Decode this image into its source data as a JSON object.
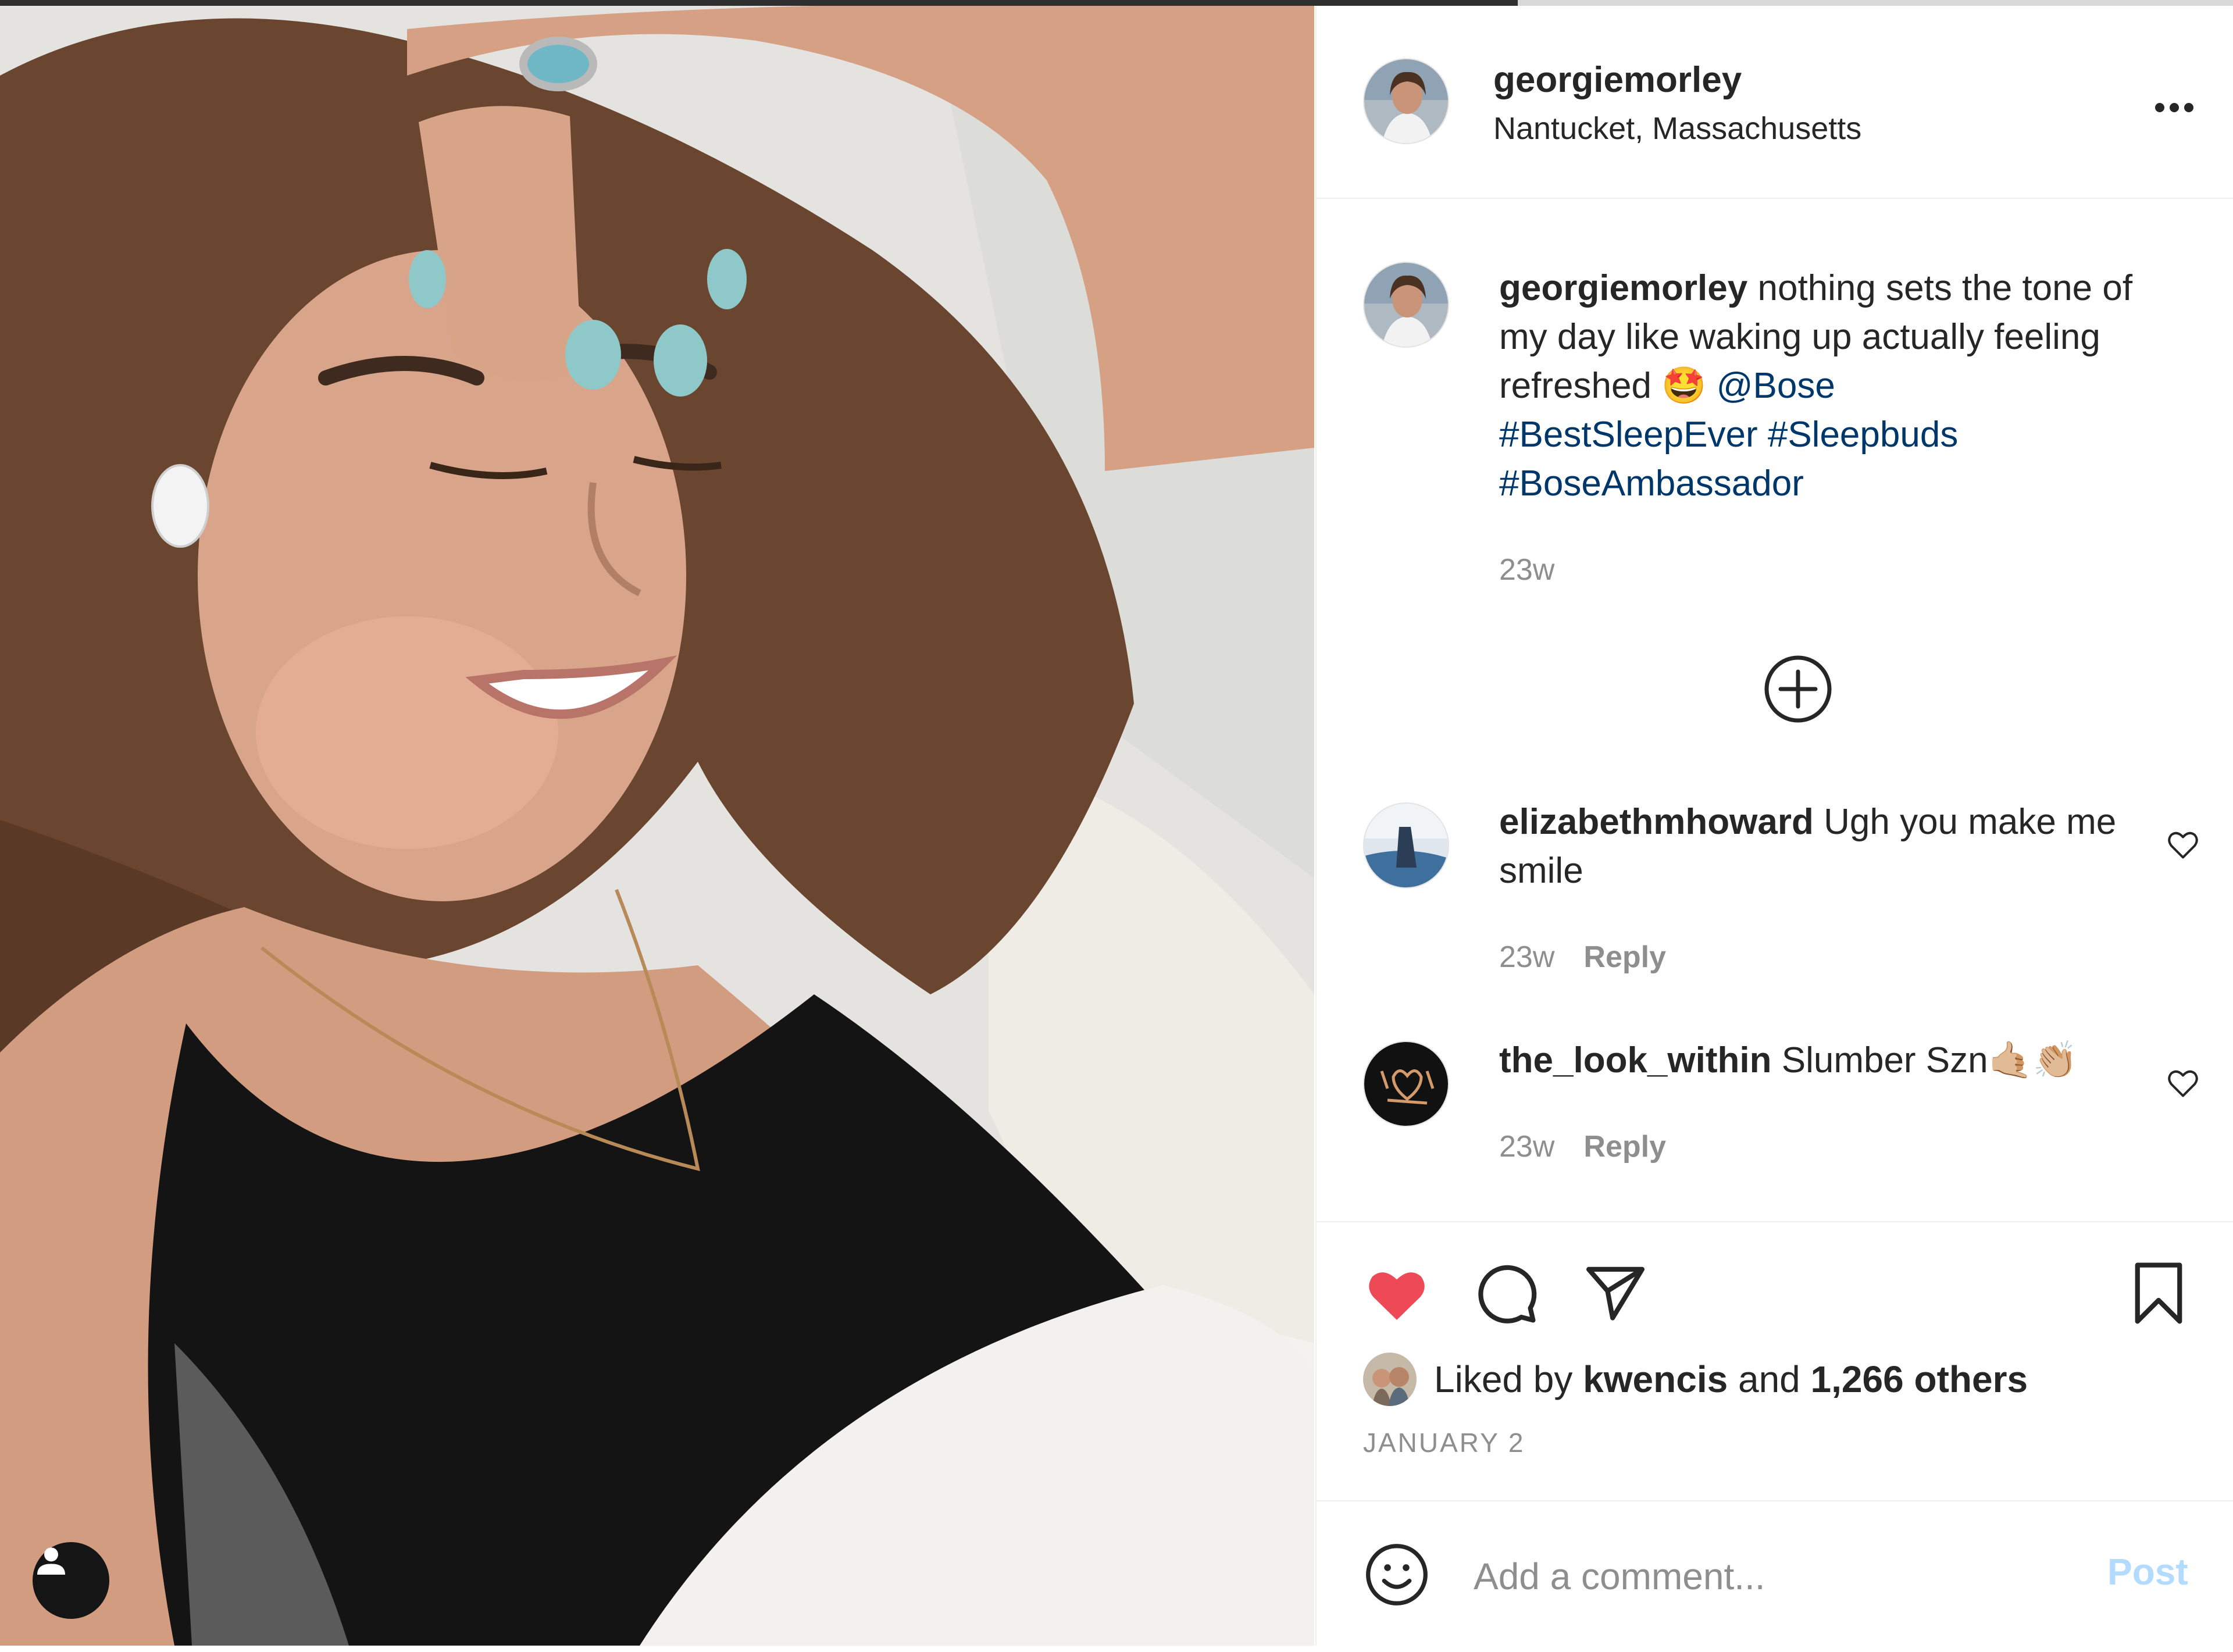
{
  "post": {
    "author": "georgiemorley",
    "location": "Nantucket, Massachusetts",
    "caption": {
      "username": "georgiemorley",
      "text": " nothing sets the tone of my day like waking up actually feeling refreshed 🤩 ",
      "mention": "@Bose",
      "hashtags": [
        "#BestSleepEver",
        "#Sleepbuds",
        "#BoseAmbassador"
      ],
      "time": "23w"
    },
    "comments": [
      {
        "username": "elizabethmhoward",
        "text": " Ugh you make me smile",
        "time": "23w",
        "reply_label": "Reply"
      },
      {
        "username": "the_look_within",
        "text": " Slumber Szn🤙🏼👏🏼",
        "time": "23w",
        "reply_label": "Reply"
      }
    ],
    "likes": {
      "prefix": "Liked by ",
      "user": "kwencis",
      "middle": " and ",
      "count": "1,266 others"
    },
    "date": "JANUARY 2",
    "comment_box": {
      "placeholder": "Add a comment...",
      "post_label": "Post"
    }
  },
  "icons": {
    "more": "more-options-icon",
    "load_more": "plus-circle-icon",
    "like": "heart-filled-icon",
    "comment": "comment-bubble-icon",
    "share": "paper-plane-icon",
    "save": "bookmark-icon",
    "emoji": "smiley-icon",
    "tagged": "user-icon"
  },
  "colors": {
    "like_red": "#ed4956",
    "link_blue": "#00376b",
    "post_button": "#b3dbff",
    "muted_gray": "#8e8e8e"
  }
}
